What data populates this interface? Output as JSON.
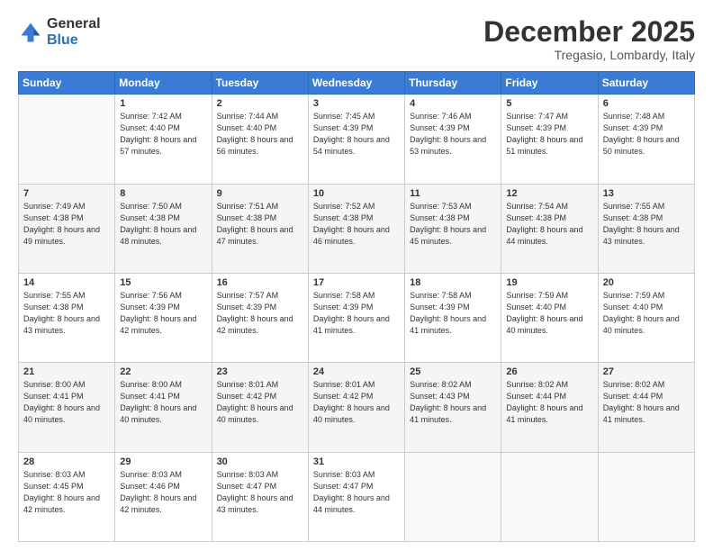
{
  "logo": {
    "general": "General",
    "blue": "Blue"
  },
  "header": {
    "month": "December 2025",
    "location": "Tregasio, Lombardy, Italy"
  },
  "weekdays": [
    "Sunday",
    "Monday",
    "Tuesday",
    "Wednesday",
    "Thursday",
    "Friday",
    "Saturday"
  ],
  "weeks": [
    [
      {
        "day": "",
        "sunrise": "",
        "sunset": "",
        "daylight": ""
      },
      {
        "day": "1",
        "sunrise": "Sunrise: 7:42 AM",
        "sunset": "Sunset: 4:40 PM",
        "daylight": "Daylight: 8 hours and 57 minutes."
      },
      {
        "day": "2",
        "sunrise": "Sunrise: 7:44 AM",
        "sunset": "Sunset: 4:40 PM",
        "daylight": "Daylight: 8 hours and 56 minutes."
      },
      {
        "day": "3",
        "sunrise": "Sunrise: 7:45 AM",
        "sunset": "Sunset: 4:39 PM",
        "daylight": "Daylight: 8 hours and 54 minutes."
      },
      {
        "day": "4",
        "sunrise": "Sunrise: 7:46 AM",
        "sunset": "Sunset: 4:39 PM",
        "daylight": "Daylight: 8 hours and 53 minutes."
      },
      {
        "day": "5",
        "sunrise": "Sunrise: 7:47 AM",
        "sunset": "Sunset: 4:39 PM",
        "daylight": "Daylight: 8 hours and 51 minutes."
      },
      {
        "day": "6",
        "sunrise": "Sunrise: 7:48 AM",
        "sunset": "Sunset: 4:39 PM",
        "daylight": "Daylight: 8 hours and 50 minutes."
      }
    ],
    [
      {
        "day": "7",
        "sunrise": "Sunrise: 7:49 AM",
        "sunset": "Sunset: 4:38 PM",
        "daylight": "Daylight: 8 hours and 49 minutes."
      },
      {
        "day": "8",
        "sunrise": "Sunrise: 7:50 AM",
        "sunset": "Sunset: 4:38 PM",
        "daylight": "Daylight: 8 hours and 48 minutes."
      },
      {
        "day": "9",
        "sunrise": "Sunrise: 7:51 AM",
        "sunset": "Sunset: 4:38 PM",
        "daylight": "Daylight: 8 hours and 47 minutes."
      },
      {
        "day": "10",
        "sunrise": "Sunrise: 7:52 AM",
        "sunset": "Sunset: 4:38 PM",
        "daylight": "Daylight: 8 hours and 46 minutes."
      },
      {
        "day": "11",
        "sunrise": "Sunrise: 7:53 AM",
        "sunset": "Sunset: 4:38 PM",
        "daylight": "Daylight: 8 hours and 45 minutes."
      },
      {
        "day": "12",
        "sunrise": "Sunrise: 7:54 AM",
        "sunset": "Sunset: 4:38 PM",
        "daylight": "Daylight: 8 hours and 44 minutes."
      },
      {
        "day": "13",
        "sunrise": "Sunrise: 7:55 AM",
        "sunset": "Sunset: 4:38 PM",
        "daylight": "Daylight: 8 hours and 43 minutes."
      }
    ],
    [
      {
        "day": "14",
        "sunrise": "Sunrise: 7:55 AM",
        "sunset": "Sunset: 4:38 PM",
        "daylight": "Daylight: 8 hours and 43 minutes."
      },
      {
        "day": "15",
        "sunrise": "Sunrise: 7:56 AM",
        "sunset": "Sunset: 4:39 PM",
        "daylight": "Daylight: 8 hours and 42 minutes."
      },
      {
        "day": "16",
        "sunrise": "Sunrise: 7:57 AM",
        "sunset": "Sunset: 4:39 PM",
        "daylight": "Daylight: 8 hours and 42 minutes."
      },
      {
        "day": "17",
        "sunrise": "Sunrise: 7:58 AM",
        "sunset": "Sunset: 4:39 PM",
        "daylight": "Daylight: 8 hours and 41 minutes."
      },
      {
        "day": "18",
        "sunrise": "Sunrise: 7:58 AM",
        "sunset": "Sunset: 4:39 PM",
        "daylight": "Daylight: 8 hours and 41 minutes."
      },
      {
        "day": "19",
        "sunrise": "Sunrise: 7:59 AM",
        "sunset": "Sunset: 4:40 PM",
        "daylight": "Daylight: 8 hours and 40 minutes."
      },
      {
        "day": "20",
        "sunrise": "Sunrise: 7:59 AM",
        "sunset": "Sunset: 4:40 PM",
        "daylight": "Daylight: 8 hours and 40 minutes."
      }
    ],
    [
      {
        "day": "21",
        "sunrise": "Sunrise: 8:00 AM",
        "sunset": "Sunset: 4:41 PM",
        "daylight": "Daylight: 8 hours and 40 minutes."
      },
      {
        "day": "22",
        "sunrise": "Sunrise: 8:00 AM",
        "sunset": "Sunset: 4:41 PM",
        "daylight": "Daylight: 8 hours and 40 minutes."
      },
      {
        "day": "23",
        "sunrise": "Sunrise: 8:01 AM",
        "sunset": "Sunset: 4:42 PM",
        "daylight": "Daylight: 8 hours and 40 minutes."
      },
      {
        "day": "24",
        "sunrise": "Sunrise: 8:01 AM",
        "sunset": "Sunset: 4:42 PM",
        "daylight": "Daylight: 8 hours and 40 minutes."
      },
      {
        "day": "25",
        "sunrise": "Sunrise: 8:02 AM",
        "sunset": "Sunset: 4:43 PM",
        "daylight": "Daylight: 8 hours and 41 minutes."
      },
      {
        "day": "26",
        "sunrise": "Sunrise: 8:02 AM",
        "sunset": "Sunset: 4:44 PM",
        "daylight": "Daylight: 8 hours and 41 minutes."
      },
      {
        "day": "27",
        "sunrise": "Sunrise: 8:02 AM",
        "sunset": "Sunset: 4:44 PM",
        "daylight": "Daylight: 8 hours and 41 minutes."
      }
    ],
    [
      {
        "day": "28",
        "sunrise": "Sunrise: 8:03 AM",
        "sunset": "Sunset: 4:45 PM",
        "daylight": "Daylight: 8 hours and 42 minutes."
      },
      {
        "day": "29",
        "sunrise": "Sunrise: 8:03 AM",
        "sunset": "Sunset: 4:46 PM",
        "daylight": "Daylight: 8 hours and 42 minutes."
      },
      {
        "day": "30",
        "sunrise": "Sunrise: 8:03 AM",
        "sunset": "Sunset: 4:47 PM",
        "daylight": "Daylight: 8 hours and 43 minutes."
      },
      {
        "day": "31",
        "sunrise": "Sunrise: 8:03 AM",
        "sunset": "Sunset: 4:47 PM",
        "daylight": "Daylight: 8 hours and 44 minutes."
      },
      {
        "day": "",
        "sunrise": "",
        "sunset": "",
        "daylight": ""
      },
      {
        "day": "",
        "sunrise": "",
        "sunset": "",
        "daylight": ""
      },
      {
        "day": "",
        "sunrise": "",
        "sunset": "",
        "daylight": ""
      }
    ]
  ]
}
